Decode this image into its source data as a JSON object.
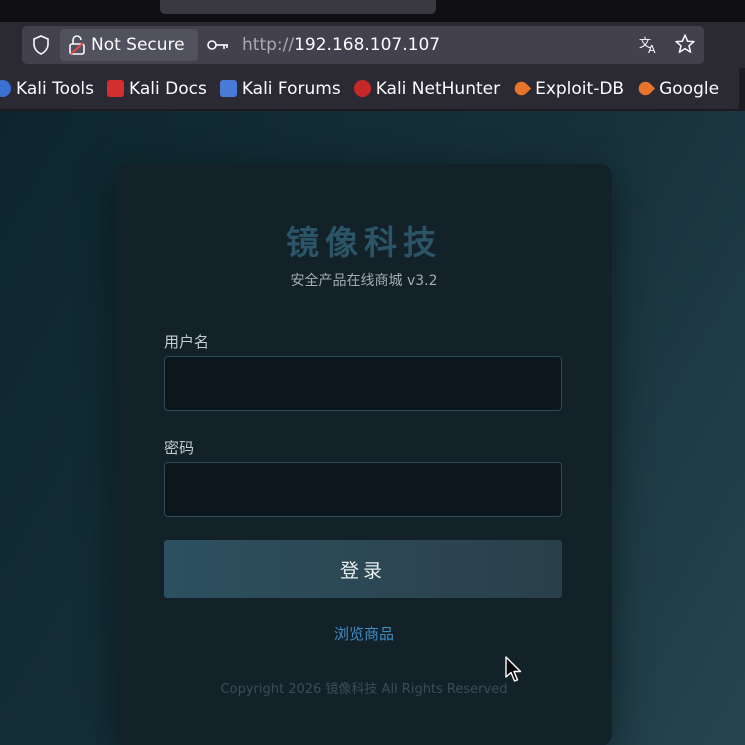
{
  "browser": {
    "security_label": "Not Secure",
    "url_protocol": "http://",
    "url_host": "192.168.107.107",
    "bookmarks": [
      {
        "label": "Kali Tools",
        "icon": "kali-tools-icon",
        "color": "#3b6fd1"
      },
      {
        "label": "Kali Docs",
        "icon": "kali-docs-icon",
        "color": "#d32f2f"
      },
      {
        "label": "Kali Forums",
        "icon": "kali-forums-icon",
        "color": "#4a7bd6"
      },
      {
        "label": "Kali NetHunter",
        "icon": "kali-nethunter-icon",
        "color": "#c62828"
      },
      {
        "label": "Exploit-DB",
        "icon": "exploit-db-icon",
        "color": "#e8742a"
      },
      {
        "label": "Google",
        "icon": "google-icon",
        "color": "#e8742a"
      }
    ]
  },
  "login": {
    "brand": "镜像科技",
    "subtitle": "安全产品在线商城 v3.2",
    "username_label": "用户名",
    "username_value": "",
    "password_label": "密码",
    "password_value": "",
    "submit_label": "登录",
    "browse_link": "浏览商品",
    "copyright": "Copyright 2026 镜像科技 All Rights Reserved"
  },
  "colors": {
    "brand": "#2b5566",
    "link": "#3f8cc3",
    "card_bg": "#132129"
  }
}
